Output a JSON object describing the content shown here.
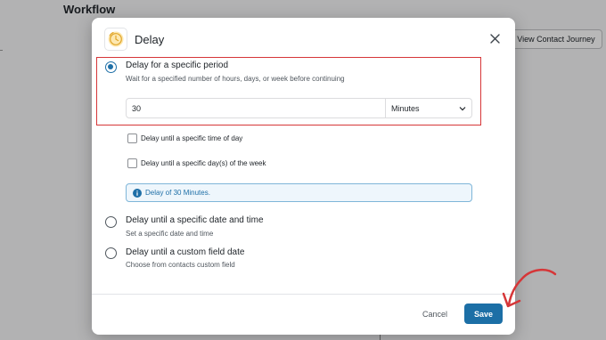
{
  "background": {
    "page_title": "Workflow",
    "journey_button_label": "View Contact Journey"
  },
  "modal": {
    "title": "Delay",
    "header_icon": "clock-icon",
    "close_icon": "close-icon",
    "options": [
      {
        "label": "Delay for a specific period",
        "description": "Wait for a specified number of hours, days, or week before continuing",
        "selected": true
      },
      {
        "label": "Delay until a specific date and time",
        "description": "Set a specific date and time",
        "selected": false
      },
      {
        "label": "Delay until a custom field date",
        "description": "Choose from contacts custom field",
        "selected": false
      }
    ],
    "period": {
      "value": "30",
      "unit": "Minutes"
    },
    "checkboxes": [
      {
        "label": "Delay until a specific time of day",
        "checked": false
      },
      {
        "label": "Delay until a specific day(s) of the week",
        "checked": false
      }
    ],
    "info": {
      "icon": "info-icon",
      "text": "Delay of 30 Minutes."
    },
    "footer": {
      "cancel_label": "Cancel",
      "save_label": "Save"
    }
  },
  "colors": {
    "accent": "#1c6fa6",
    "highlight": "#d63638",
    "info_bg": "#eef6fc"
  }
}
